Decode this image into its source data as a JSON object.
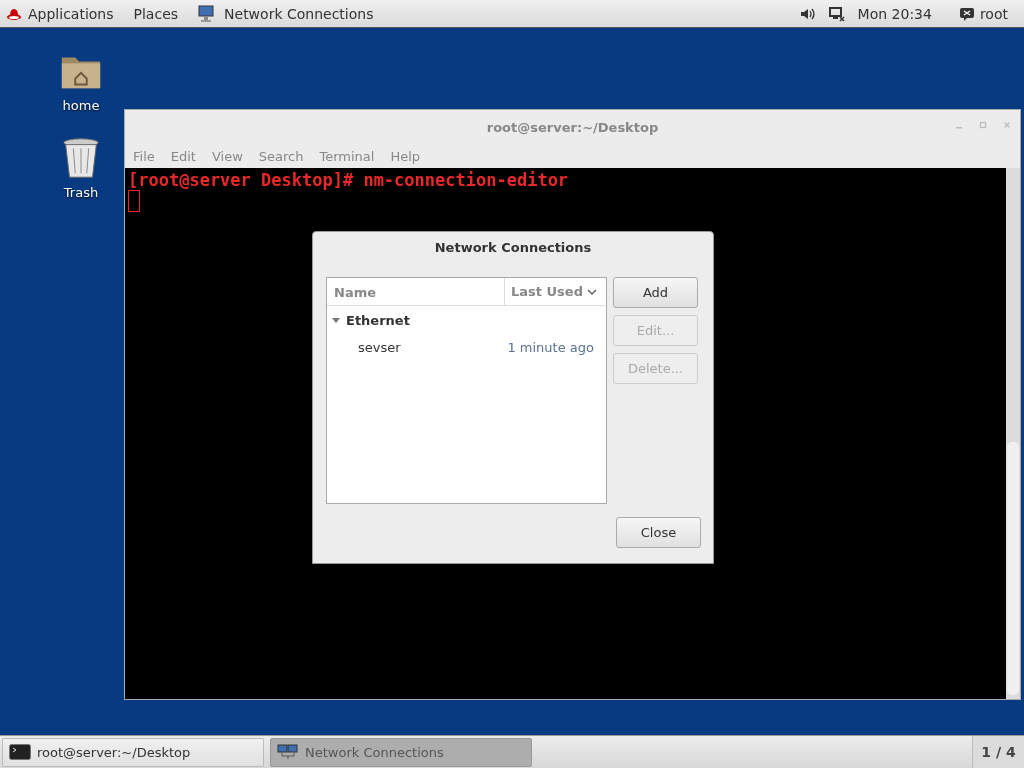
{
  "top_bar": {
    "menus": [
      {
        "label": "Applications",
        "kind": "logo"
      },
      {
        "label": "Places",
        "kind": "plain"
      }
    ],
    "active_app": "Network Connections",
    "clock": "Mon 20:34",
    "user": "root"
  },
  "desktop_icons": [
    {
      "label": "home",
      "kind": "folder"
    },
    {
      "label": "Trash",
      "kind": "trash"
    }
  ],
  "terminal": {
    "title": "root@server:~/Desktop",
    "menu": [
      "File",
      "Edit",
      "View",
      "Search",
      "Terminal",
      "Help"
    ],
    "lines": [
      "[root@server Desktop]# nm-connection-editor"
    ]
  },
  "dialog": {
    "title": "Network Connections",
    "columns": [
      "Name",
      "Last Used"
    ],
    "groups": [
      {
        "name": "Ethernet",
        "expanded": true,
        "children": [
          {
            "name": "sevser",
            "last_used": "1 minute ago"
          }
        ]
      }
    ],
    "buttons": [
      {
        "label": "Add",
        "disabled": false
      },
      {
        "label": "Edit...",
        "disabled": true
      },
      {
        "label": "Delete...",
        "disabled": true
      }
    ],
    "close": "Close"
  },
  "taskbar": {
    "tasks": [
      {
        "label": "root@server:~/Desktop",
        "kind": "terminal",
        "selected": false
      },
      {
        "label": "Network Connections",
        "kind": "network",
        "selected": true
      }
    ],
    "workspace": "1 / 4"
  }
}
